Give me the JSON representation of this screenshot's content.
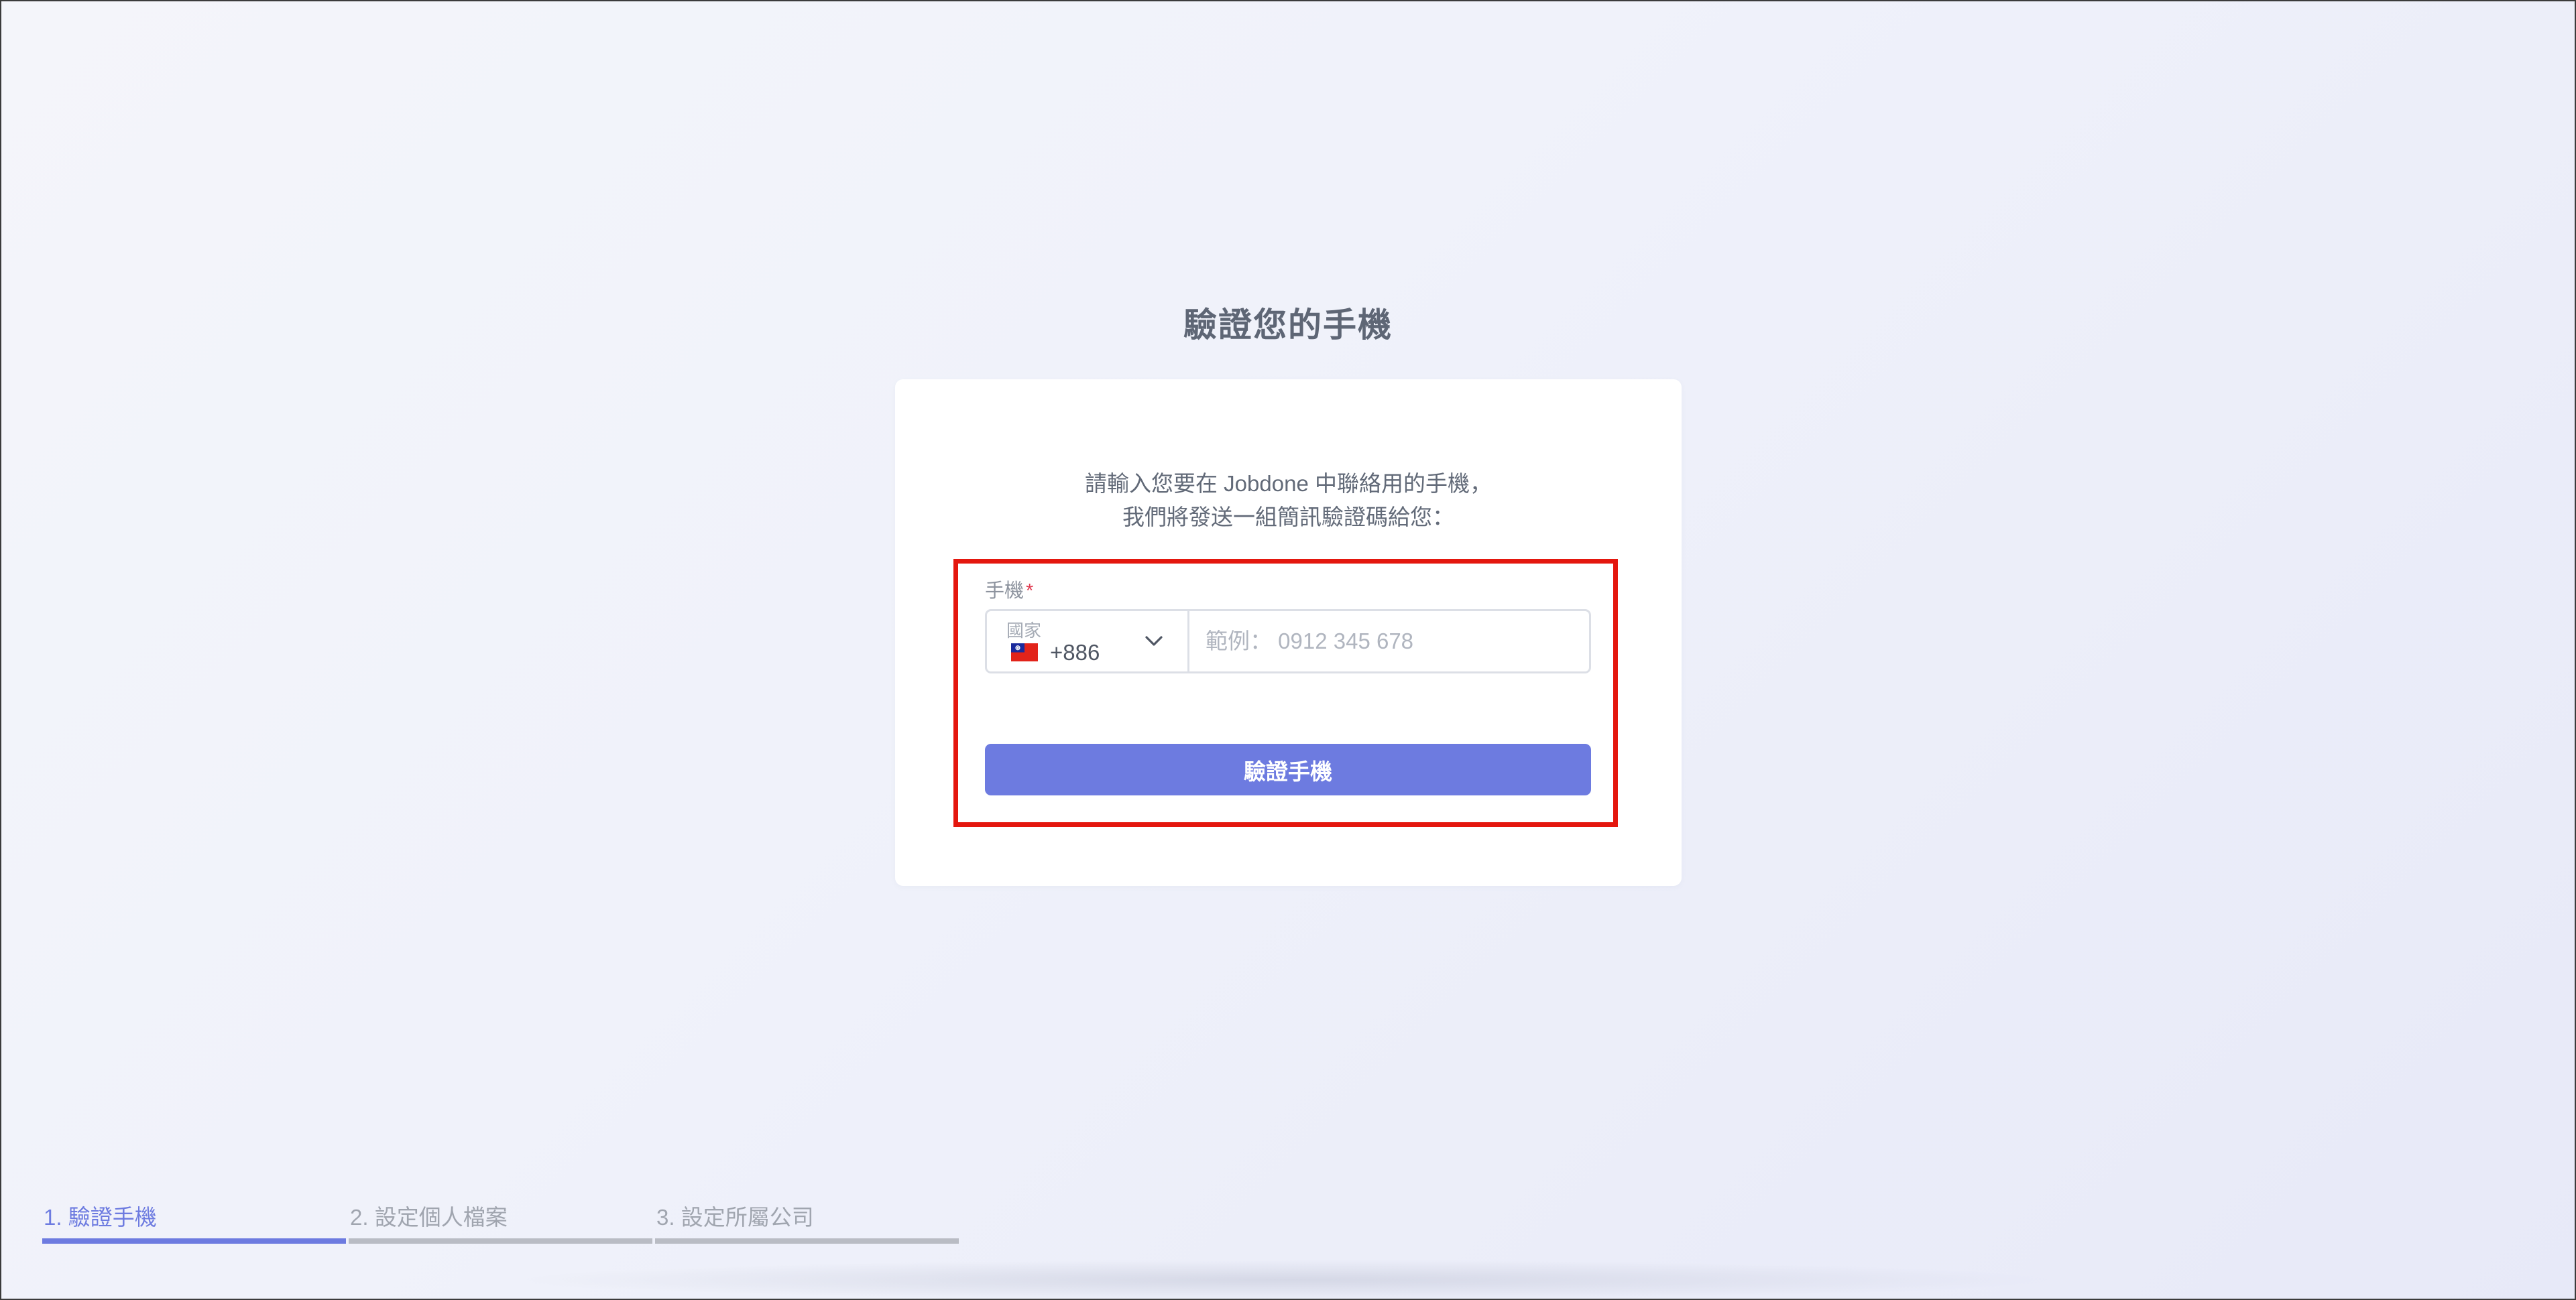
{
  "page": {
    "title": "驗證您的手機",
    "instructions": [
      "請輸入您要在 Jobdone 中聯絡用的手機，",
      "我們將發送一組簡訊驗證碼給您："
    ]
  },
  "form": {
    "phone_label": "手機",
    "required_mark": "*",
    "country_caption": "國家",
    "country_flag": "taiwan-flag-icon",
    "dial_code": "+886",
    "phone_value": "",
    "phone_placeholder": "範例： 0912 345 678",
    "submit_label": "驗證手機"
  },
  "steps": [
    {
      "label": "1. 驗證手機",
      "active": true
    },
    {
      "label": "2. 設定個人檔案",
      "active": false
    },
    {
      "label": "3. 設定所屬公司",
      "active": false
    }
  ],
  "colors": {
    "accent": "#6d7be0",
    "highlight_box": "#e4170e",
    "required": "#e0394f"
  }
}
